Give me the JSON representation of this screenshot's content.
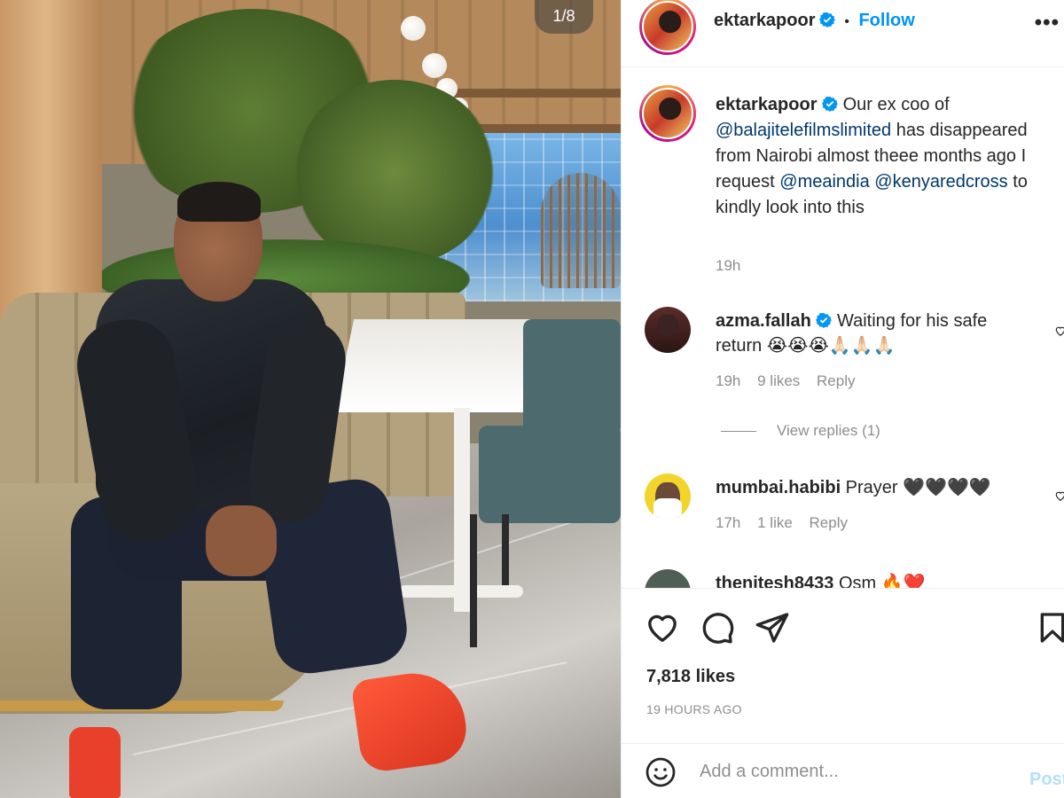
{
  "photo": {
    "counter": "1/8"
  },
  "header": {
    "username": "ektarkapoor",
    "separator": "•",
    "follow_label": "Follow",
    "more_icon": "more-horizontal-icon"
  },
  "caption": {
    "username": "ektarkapoor",
    "text_1": " Our ex coo of ",
    "mention_1": "@balajitelefilmslimited",
    "text_2": " has disappeared from Nairobi almost theee months ago I request ",
    "mention_2": "@meaindia",
    "text_3": " ",
    "mention_3": "@kenyaredcross",
    "text_4": " to kindly look into this",
    "time": "19h"
  },
  "comments": [
    {
      "username": "azma.fallah",
      "text": " Waiting for his safe return 😭😭😭🙏🏻🙏🏻🙏🏻",
      "time": "19h",
      "likes": "9 likes",
      "reply": "Reply",
      "view_replies": "View replies (1)"
    },
    {
      "username": "mumbai.habibi",
      "text": " Prayer 🖤🖤🖤🖤",
      "time": "17h",
      "likes": "1 like",
      "reply": "Reply"
    },
    {
      "username": "thenitesh8433",
      "text": " Osm 🔥❤️"
    }
  ],
  "actions": {
    "like_icon": "heart-icon",
    "comment_icon": "comment-icon",
    "share_icon": "send-icon",
    "save_icon": "bookmark-icon",
    "likes": "7,818 likes",
    "posted_ago": "19 HOURS AGO"
  },
  "add_comment": {
    "emoji_icon": "smiley-icon",
    "placeholder": "Add a comment...",
    "post_label": "Post"
  },
  "colors": {
    "accent": "#0095f6",
    "mention": "#00376b",
    "muted": "#8e8e8e",
    "text": "#262626",
    "post_disabled": "#b2dffc"
  }
}
